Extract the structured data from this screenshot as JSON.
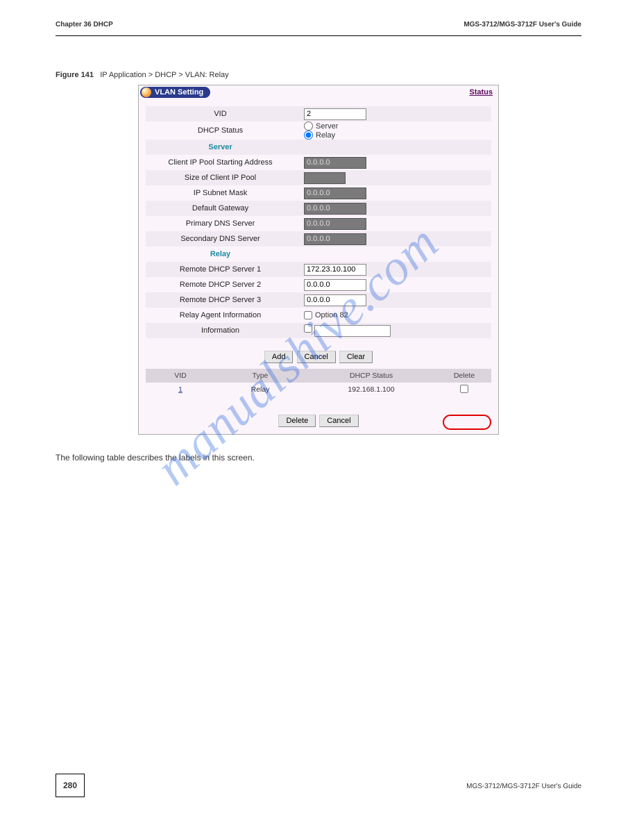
{
  "header": {
    "left": "Chapter 36 DHCP",
    "right": "MGS-3712/MGS-3712F User's Guide"
  },
  "figure": {
    "label": "Figure 141",
    "caption": "IP Application > DHCP > VLAN: Relay"
  },
  "panel": {
    "title": "VLAN Setting",
    "status_link": "Status",
    "vid": {
      "label": "VID",
      "value": "2"
    },
    "dhcp_status": {
      "label": "DHCP Status",
      "opt_server": "Server",
      "opt_relay": "Relay",
      "selected": "relay"
    },
    "server_head": "Server",
    "server": {
      "client_ip_start": {
        "label": "Client IP Pool Starting Address",
        "value": "0.0.0.0"
      },
      "pool_size": {
        "label": "Size of Client IP Pool",
        "value": ""
      },
      "subnet_mask": {
        "label": "IP Subnet Mask",
        "value": "0.0.0.0"
      },
      "default_gw": {
        "label": "Default Gateway",
        "value": "0.0.0.0"
      },
      "primary_dns": {
        "label": "Primary DNS Server",
        "value": "0.0.0.0"
      },
      "secondary_dns": {
        "label": "Secondary DNS Server",
        "value": "0.0.0.0"
      }
    },
    "relay_head": "Relay",
    "relay": {
      "srv1": {
        "label": "Remote DHCP Server 1",
        "value": "172.23.10.100"
      },
      "srv2": {
        "label": "Remote DHCP Server 2",
        "value": "0.0.0.0"
      },
      "srv3": {
        "label": "Remote DHCP Server 3",
        "value": "0.0.0.0"
      },
      "agent_info": {
        "label": "Relay Agent Information",
        "opt": "Option 82"
      },
      "info": {
        "label": "Information",
        "value": ""
      }
    },
    "buttons_top": {
      "add": "Add",
      "cancel": "Cancel",
      "clear": "Clear"
    },
    "table": {
      "headers": {
        "vid": "VID",
        "type": "Type",
        "status": "DHCP Status",
        "del": "Delete"
      },
      "rows": [
        {
          "vid": "1",
          "type": "Relay",
          "status": "192.168.1.100"
        }
      ]
    },
    "buttons_bottom": {
      "delete": "Delete",
      "cancel": "Cancel"
    }
  },
  "body_text": "The following table describes the labels in this screen.",
  "footer": {
    "page": "280"
  },
  "watermark": "manualshive.com"
}
